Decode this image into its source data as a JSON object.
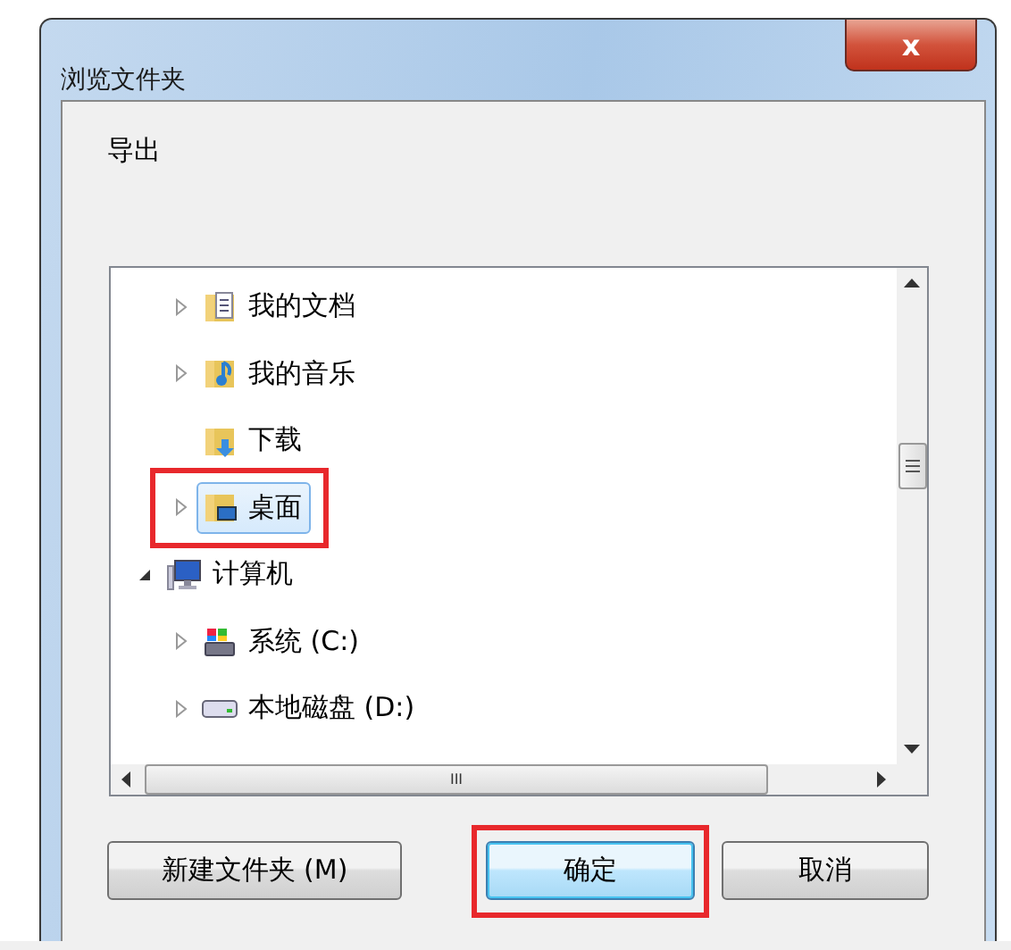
{
  "window": {
    "title": "浏览文件夹",
    "close_symbol": "x"
  },
  "description": "导出",
  "tree": {
    "items": [
      {
        "kind": "offscreen",
        "children": [
          {
            "kind": "documents",
            "label": "我的文档",
            "has_children": true,
            "expanded": false,
            "selected": false,
            "highlighted": false
          },
          {
            "kind": "music",
            "label": "我的音乐",
            "has_children": true,
            "expanded": false,
            "selected": false,
            "highlighted": false
          },
          {
            "kind": "downloads",
            "label": "下载",
            "has_children": false,
            "selected": false,
            "highlighted": false
          },
          {
            "kind": "desktop",
            "label": "桌面",
            "has_children": true,
            "expanded": false,
            "selected": true,
            "highlighted": true
          }
        ]
      },
      {
        "kind": "computer",
        "label": "计算机",
        "has_children": true,
        "expanded": true,
        "selected": false,
        "highlighted": false,
        "children": [
          {
            "kind": "system",
            "label": "系统 (C:)",
            "has_children": true,
            "expanded": false,
            "selected": false,
            "highlighted": false
          },
          {
            "kind": "drive",
            "label": "本地磁盘 (D:)",
            "has_children": true,
            "expanded": false,
            "selected": false,
            "highlighted": false
          }
        ]
      }
    ],
    "hscroll_thumb": "III"
  },
  "buttons": [
    {
      "label": "新建文件夹 (M)",
      "default": false,
      "highlighted": false
    },
    {
      "label": "确定",
      "default": true,
      "highlighted": true
    },
    {
      "label": "取消",
      "default": false,
      "highlighted": false
    }
  ]
}
